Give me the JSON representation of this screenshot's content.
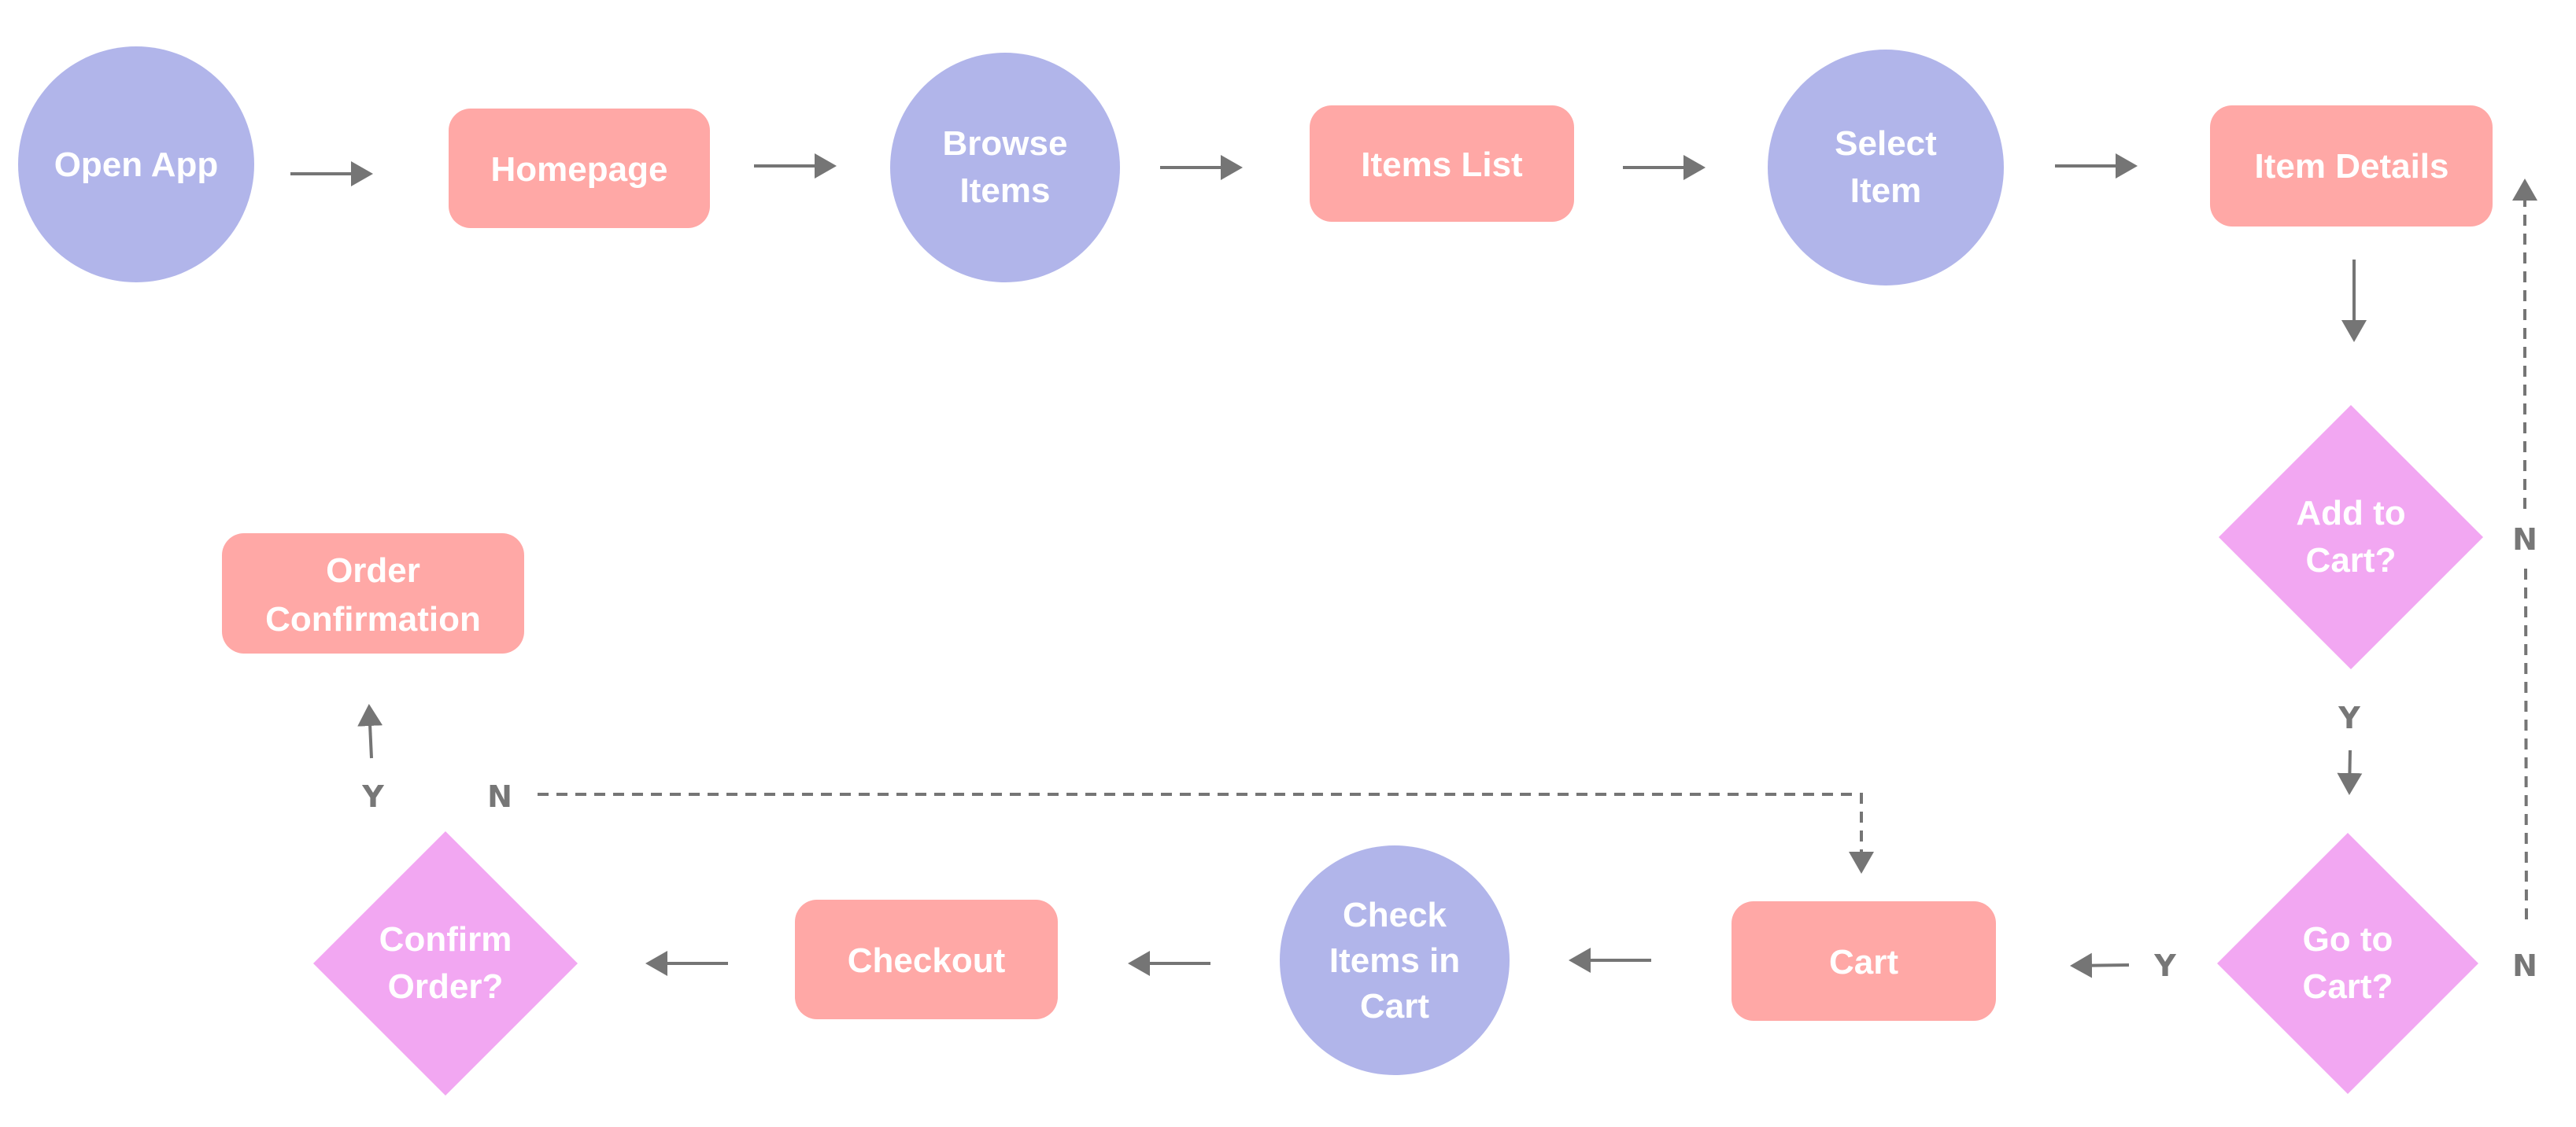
{
  "colors": {
    "start_circle": "#b1b5ea",
    "process_rect": "#ffa8a6",
    "decision_diamond": "#f2a7f2",
    "arrow": "#757575",
    "edge_label": "#777777"
  },
  "nodes": {
    "open_app": {
      "shape": "circle",
      "lines": [
        "Open App"
      ]
    },
    "homepage": {
      "shape": "rounded-rect",
      "lines": [
        "Homepage"
      ]
    },
    "browse_items": {
      "shape": "circle",
      "lines": [
        "Browse",
        "Items"
      ]
    },
    "items_list": {
      "shape": "rounded-rect",
      "lines": [
        "Items List"
      ]
    },
    "select_item": {
      "shape": "circle",
      "lines": [
        "Select",
        "Item"
      ]
    },
    "item_details": {
      "shape": "rounded-rect",
      "lines": [
        "Item Details"
      ]
    },
    "add_to_cart": {
      "shape": "diamond",
      "lines": [
        "Add to",
        "Cart?"
      ]
    },
    "go_to_cart": {
      "shape": "diamond",
      "lines": [
        "Go to",
        "Cart?"
      ]
    },
    "cart": {
      "shape": "rounded-rect",
      "lines": [
        "Cart"
      ]
    },
    "check_items": {
      "shape": "circle",
      "lines": [
        "Check",
        "Items in",
        "Cart"
      ]
    },
    "checkout": {
      "shape": "rounded-rect",
      "lines": [
        "Checkout"
      ]
    },
    "confirm_order": {
      "shape": "diamond",
      "lines": [
        "Confirm",
        "Order?"
      ]
    },
    "order_confirmation": {
      "shape": "rounded-rect",
      "lines": [
        "Order",
        "Confirmation"
      ]
    }
  },
  "edge_labels": {
    "add_to_cart_yes": "Y",
    "add_to_cart_no": "N",
    "go_to_cart_yes": "Y",
    "go_to_cart_no": "N",
    "confirm_order_yes": "Y",
    "confirm_order_no": "N"
  }
}
